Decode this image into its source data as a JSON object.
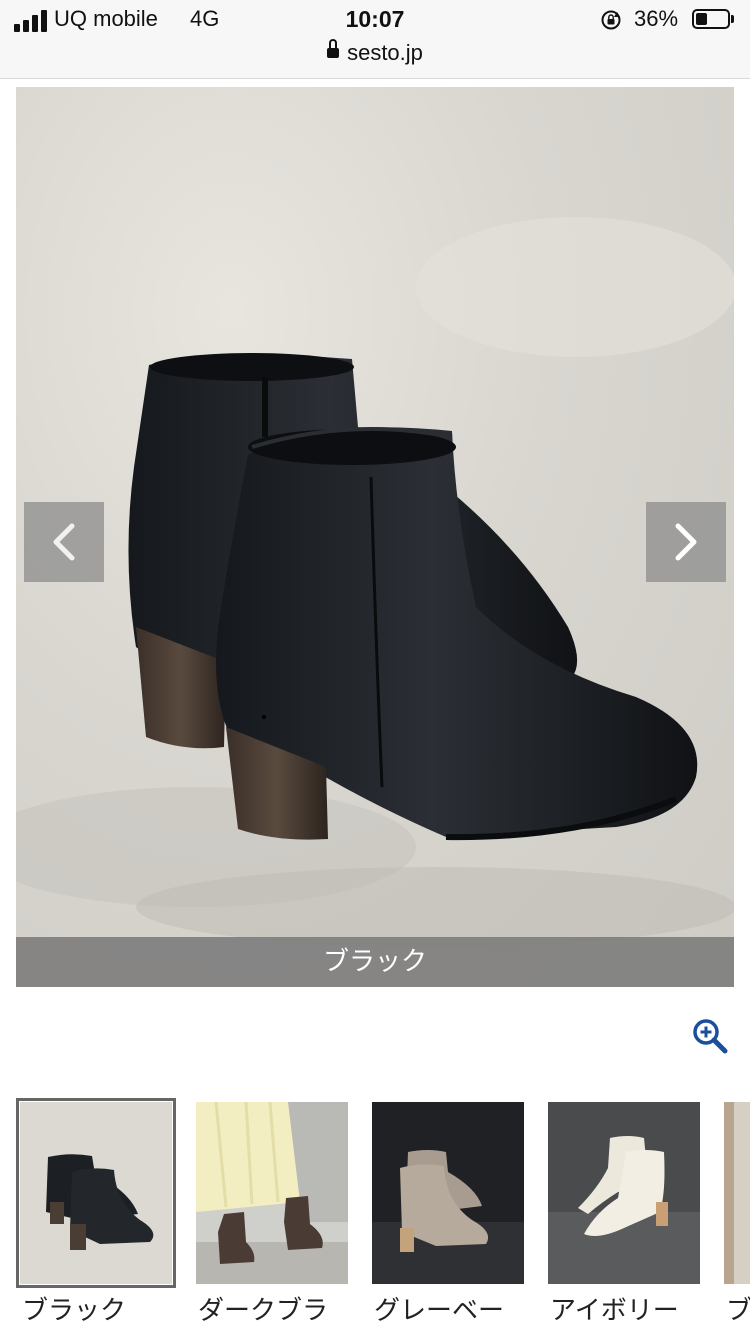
{
  "status": {
    "carrier": "UQ mobile",
    "network": "4G",
    "time": "10:07",
    "battery": "36%",
    "battery_level": 0.36,
    "url": "sesto.jp"
  },
  "gallery": {
    "caption": "ブラック",
    "prev_icon": "chevron-left-icon",
    "next_icon": "chevron-right-icon",
    "zoom_icon": "zoom-in-icon",
    "accent_color": "#1b4f9c"
  },
  "thumbnails": [
    {
      "label": "ブラック",
      "selected": true
    },
    {
      "label": "ダークブラ",
      "selected": false
    },
    {
      "label": "グレーベー",
      "selected": false
    },
    {
      "label": "アイボリー",
      "selected": false
    },
    {
      "label": "ブ",
      "selected": false
    }
  ]
}
